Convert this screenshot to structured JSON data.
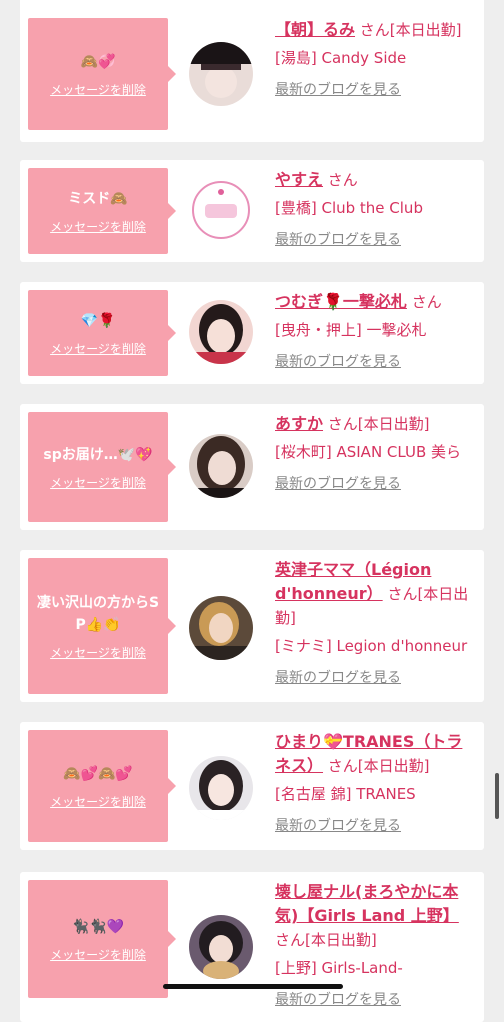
{
  "delete_label": "メッセージを削除",
  "blog_label": "最新のブログを見る",
  "colors": {
    "background": "#eeeeee",
    "bubble": "#f7a1ad",
    "accent": "#d6335f",
    "link_gray": "#888888"
  },
  "items": [
    {
      "message": "🙈💞",
      "name": "【朝】るみ",
      "suffix": "さん[本日出勤]",
      "shop": "[湯島] Candy Side"
    },
    {
      "message": "ミスド🙈",
      "name": "やすえ",
      "suffix": "さん",
      "shop": "[豊橋] Club the Club"
    },
    {
      "message": "💎🌹",
      "name": "つむぎ🌹一撃必札",
      "suffix": "さん",
      "shop": "[曳舟・押上] 一撃必札"
    },
    {
      "message": "spお届け…🕊️💖",
      "name": "あすか",
      "suffix": "さん[本日出勤]",
      "shop": "[桜木町] ASIAN CLUB 美ら"
    },
    {
      "message": "凄い沢山の方からSP👍👏",
      "name": "英津子ママ（Légion d'honneur）",
      "suffix": "さん[本日出勤]",
      "shop": "[ミナミ] Legion d'honneur"
    },
    {
      "message": "🙈💕🙈💕",
      "name": "ひまり💝TRANES（トラネス）",
      "suffix": "さん[本日出勤]",
      "shop": "[名古屋 錦] TRANES"
    },
    {
      "message": "🐈‍⬛🐈‍⬛💜",
      "name": "壊し屋ナル(まろやかに本気)【Girls Land 上野】",
      "suffix": "さん[本日出勤]",
      "shop": "[上野] Girls-Land-"
    }
  ]
}
